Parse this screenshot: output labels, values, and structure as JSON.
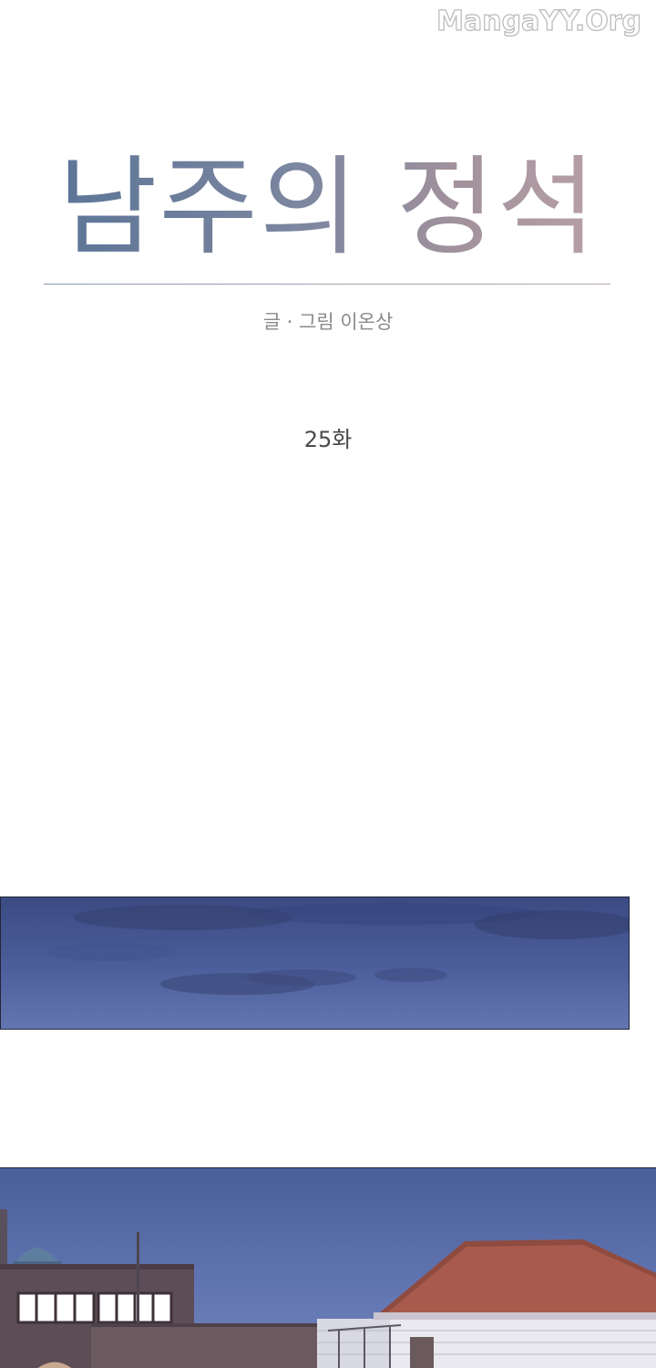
{
  "watermark": "MangaYY.Org",
  "cover": {
    "title": "남주의 정석",
    "credits": "글 · 그림 이온상",
    "episode": "25화"
  },
  "colors": {
    "background": "#ffffff",
    "title_start": "#5c7597",
    "title_end": "#b7a0a8",
    "sky": "#4c5f9c",
    "roof": "#a85a4c"
  }
}
